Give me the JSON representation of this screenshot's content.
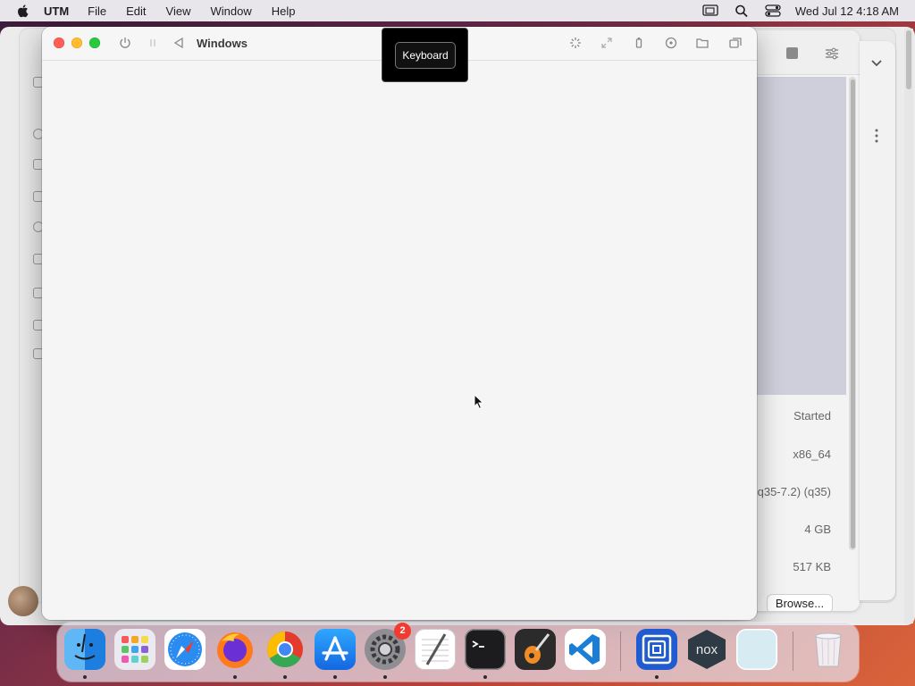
{
  "menubar": {
    "app_name": "UTM",
    "menus": [
      "File",
      "Edit",
      "View",
      "Window",
      "Help"
    ],
    "clock": "Wed Jul 12  4:18 AM"
  },
  "vm_window": {
    "title": "Windows",
    "tooltip": "Keyboard"
  },
  "details_panel": {
    "status": "Started",
    "architecture": "x86_64",
    "machine": "q35-7.2) (q35)",
    "memory": "4 GB",
    "size": "517 KB",
    "browse_button": "Browse..."
  },
  "dock": {
    "settings_badge": "2",
    "nox_label": "nox"
  },
  "colors": {
    "close": "#fe5f57",
    "minimize": "#febc2e",
    "maximize": "#28c840",
    "badge": "#f23b30"
  }
}
